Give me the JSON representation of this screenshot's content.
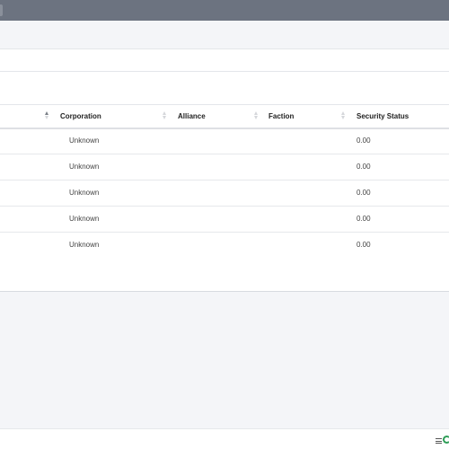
{
  "table": {
    "columns": [
      {
        "label": "",
        "sorted": "asc"
      },
      {
        "label": "Corporation",
        "sorted": "none"
      },
      {
        "label": "Alliance",
        "sorted": "none"
      },
      {
        "label": "Faction",
        "sorted": "none"
      },
      {
        "label": "Security Status",
        "sorted": "none"
      }
    ],
    "rows": [
      {
        "corporation": "Unknown",
        "alliance": "",
        "faction": "",
        "security_status": "0.00"
      },
      {
        "corporation": "Unknown",
        "alliance": "",
        "faction": "",
        "security_status": "0.00"
      },
      {
        "corporation": "Unknown",
        "alliance": "",
        "faction": "",
        "security_status": "0.00"
      },
      {
        "corporation": "Unknown",
        "alliance": "",
        "faction": "",
        "security_status": "0.00"
      },
      {
        "corporation": "Unknown",
        "alliance": "",
        "faction": "",
        "security_status": "0.00"
      }
    ]
  },
  "footer": {
    "icons": [
      "menu-icon",
      "refresh-icon"
    ],
    "refresh_color": "#2f9e58"
  },
  "colors": {
    "topbar": "#6c7380",
    "background": "#f4f5f8"
  }
}
